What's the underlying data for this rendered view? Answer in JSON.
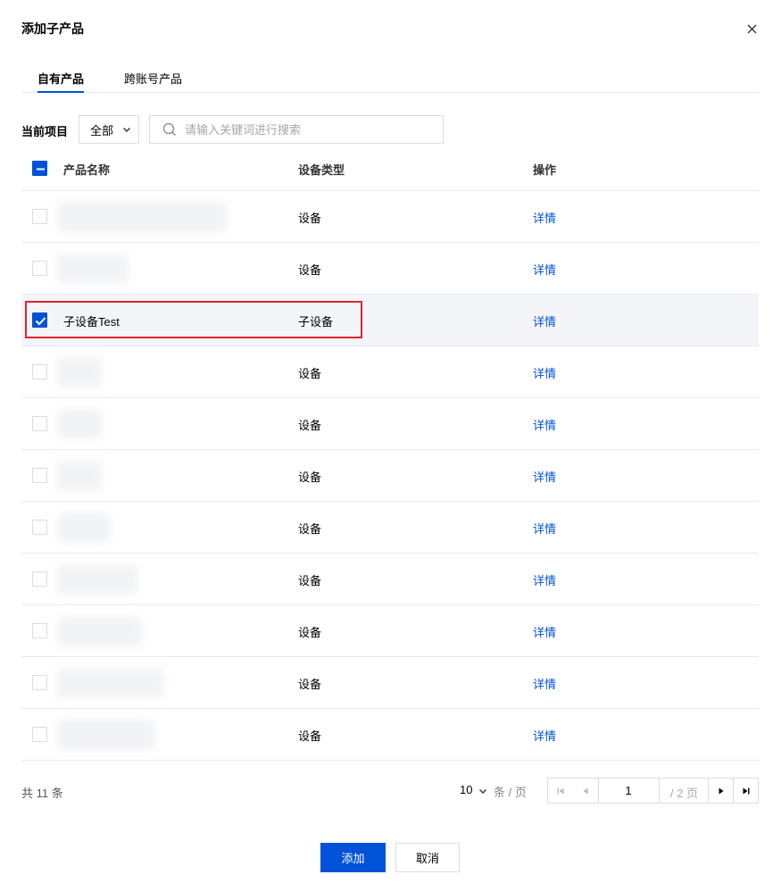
{
  "dialog": {
    "title": "添加子产品"
  },
  "tabs": [
    {
      "label": "自有产品",
      "active": true
    },
    {
      "label": "跨账号产品",
      "active": false
    }
  ],
  "filter": {
    "label": "当前项目",
    "select_value": "全部",
    "search_placeholder": "请输入关键词进行搜索"
  },
  "table": {
    "columns": [
      "产品名称",
      "设备类型",
      "操作"
    ],
    "rows": [
      {
        "name": "",
        "type": "设备",
        "op": "详情",
        "checked": false
      },
      {
        "name": "",
        "type": "设备",
        "op": "详情",
        "checked": false
      },
      {
        "name": "子设备Test",
        "type": "子设备",
        "op": "详情",
        "checked": true
      },
      {
        "name": "",
        "type": "设备",
        "op": "详情",
        "checked": false
      },
      {
        "name": "",
        "type": "设备",
        "op": "详情",
        "checked": false
      },
      {
        "name": "",
        "type": "设备",
        "op": "详情",
        "checked": false
      },
      {
        "name": "",
        "type": "设备",
        "op": "详情",
        "checked": false
      },
      {
        "name": "",
        "type": "设备",
        "op": "详情",
        "checked": false
      },
      {
        "name": "",
        "type": "设备",
        "op": "详情",
        "checked": false
      },
      {
        "name": "",
        "type": "设备",
        "op": "详情",
        "checked": false
      },
      {
        "name": "",
        "type": "设备",
        "op": "详情",
        "checked": false
      }
    ]
  },
  "pagination": {
    "total": "共 11 条",
    "page_size": "10",
    "page_size_unit": "条 / 页",
    "current_page": "1",
    "total_pages": "/ 2 页"
  },
  "footer": {
    "confirm_label": "添加",
    "cancel_label": "取消"
  },
  "colors": {
    "accent": "#0052d9",
    "highlight": "#e0242f",
    "selected_row": "#f3f5f8"
  },
  "icons": [
    "close-icon",
    "chevron-down-icon",
    "search-icon",
    "check-icon",
    "minus-icon",
    "first-page-icon",
    "prev-page-icon",
    "next-page-icon",
    "last-page-icon"
  ]
}
